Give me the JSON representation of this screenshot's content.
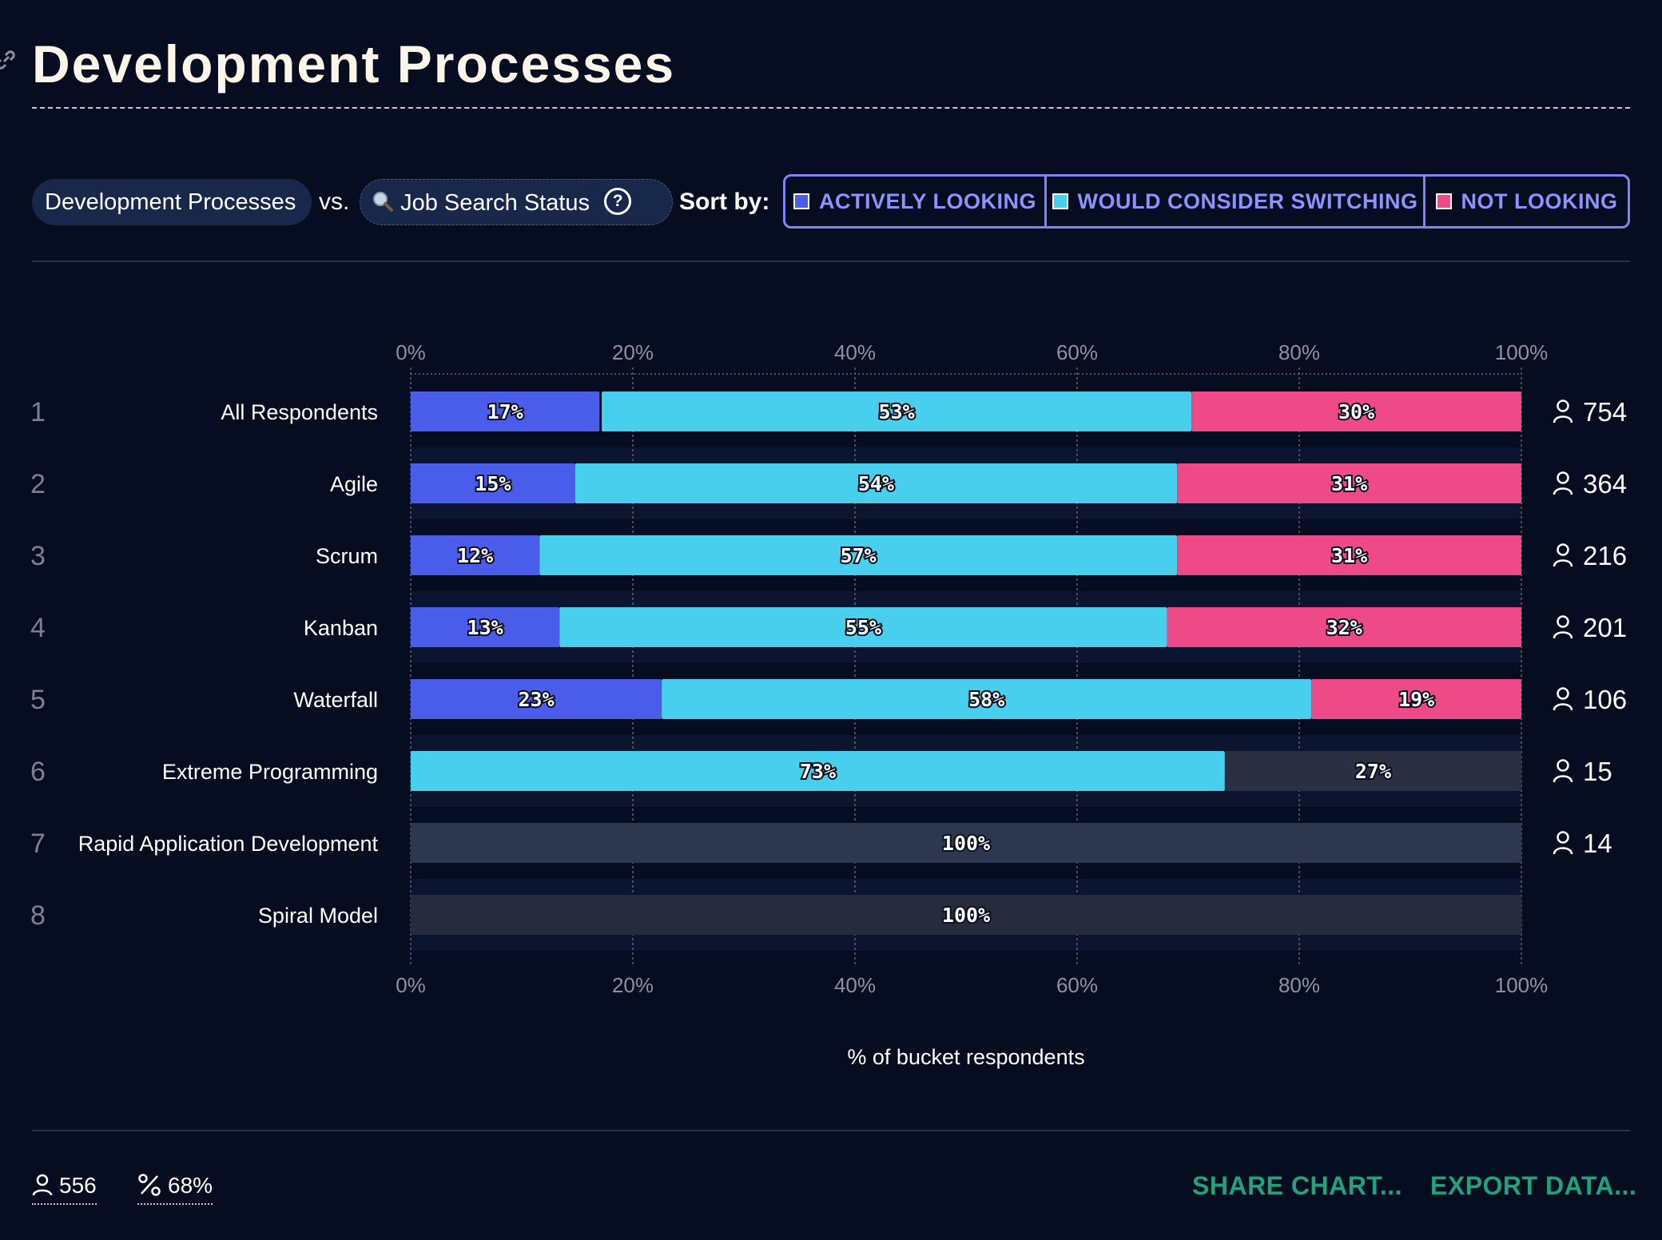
{
  "title": "Development Processes",
  "controls": {
    "pill1": "Development Processes",
    "vs": "vs.",
    "pill2": "Job Search Status",
    "help": "?",
    "sort_by": "Sort by:",
    "sort_options": [
      "ACTIVELY LOOKING",
      "WOULD CONSIDER SWITCHING",
      "NOT LOOKING"
    ]
  },
  "chart_data": {
    "type": "bar",
    "orientation": "horizontal",
    "stacked": true,
    "xlabel": "% of bucket respondents",
    "xlim": [
      0,
      100
    ],
    "x_ticks": [
      "0%",
      "20%",
      "40%",
      "60%",
      "80%",
      "100%"
    ],
    "grid": true,
    "categories": [
      "All Respondents",
      "Agile",
      "Scrum",
      "Kanban",
      "Waterfall",
      "Extreme Programming",
      "Rapid Application Development",
      "Spiral Model"
    ],
    "row_numbers": [
      "1",
      "2",
      "3",
      "4",
      "5",
      "6",
      "7",
      "8"
    ],
    "respondent_counts": [
      "754",
      "364",
      "216",
      "201",
      "106",
      "15",
      "14",
      ""
    ],
    "series": [
      {
        "name": "ACTIVELY LOOKING",
        "color": "#4a5cea",
        "values": [
          17,
          15,
          12,
          13,
          23,
          0,
          0,
          0
        ]
      },
      {
        "name": "WOULD CONSIDER SWITCHING",
        "color": "#48cfee",
        "values": [
          53,
          54,
          57,
          55,
          58,
          73,
          0,
          0
        ]
      },
      {
        "name": "NOT LOOKING",
        "color": "#ee4a88",
        "values": [
          30,
          31,
          31,
          32,
          19,
          0,
          0,
          0
        ]
      },
      {
        "name": "",
        "color": "#2a3042",
        "values": [
          0,
          0,
          0,
          0,
          0,
          27,
          100,
          100
        ]
      }
    ],
    "row_segments": [
      [
        {
          "series": 0,
          "start": 0,
          "value": 17,
          "label": "17%"
        },
        {
          "series": 1,
          "start": 17.2,
          "value": 53.1,
          "label": "53%"
        },
        {
          "series": 2,
          "start": 70.3,
          "value": 29.7,
          "label": "30%"
        }
      ],
      [
        {
          "series": 0,
          "start": 0,
          "value": 14.8,
          "label": "15%"
        },
        {
          "series": 1,
          "start": 14.8,
          "value": 54.2,
          "label": "54%"
        },
        {
          "series": 2,
          "start": 69.0,
          "value": 31.0,
          "label": "31%"
        }
      ],
      [
        {
          "series": 0,
          "start": 0,
          "value": 11.6,
          "label": "12%"
        },
        {
          "series": 1,
          "start": 11.6,
          "value": 57.4,
          "label": "57%"
        },
        {
          "series": 2,
          "start": 69.0,
          "value": 31.0,
          "label": "31%"
        }
      ],
      [
        {
          "series": 0,
          "start": 0,
          "value": 13.4,
          "label": "13%"
        },
        {
          "series": 1,
          "start": 13.4,
          "value": 54.7,
          "label": "55%"
        },
        {
          "series": 2,
          "start": 68.1,
          "value": 31.9,
          "label": "32%"
        }
      ],
      [
        {
          "series": 0,
          "start": 0,
          "value": 22.6,
          "label": "23%"
        },
        {
          "series": 1,
          "start": 22.6,
          "value": 58.5,
          "label": "58%"
        },
        {
          "series": 2,
          "start": 81.1,
          "value": 18.9,
          "label": "19%"
        }
      ],
      [
        {
          "series": 1,
          "start": 0,
          "value": 73.3,
          "label": "73%"
        },
        {
          "series": 3,
          "start": 73.3,
          "value": 26.7,
          "label": "27%"
        }
      ],
      [
        {
          "series": 3,
          "start": 0,
          "value": 100,
          "label": "100%",
          "color": "#2c3850"
        }
      ],
      [
        {
          "series": 3,
          "start": 0,
          "value": 100,
          "label": "100%",
          "color": "#262c3e"
        }
      ]
    ]
  },
  "footer": {
    "respondents": "556",
    "percent": "68%",
    "share": "SHARE CHART...",
    "export": "EXPORT DATA..."
  }
}
